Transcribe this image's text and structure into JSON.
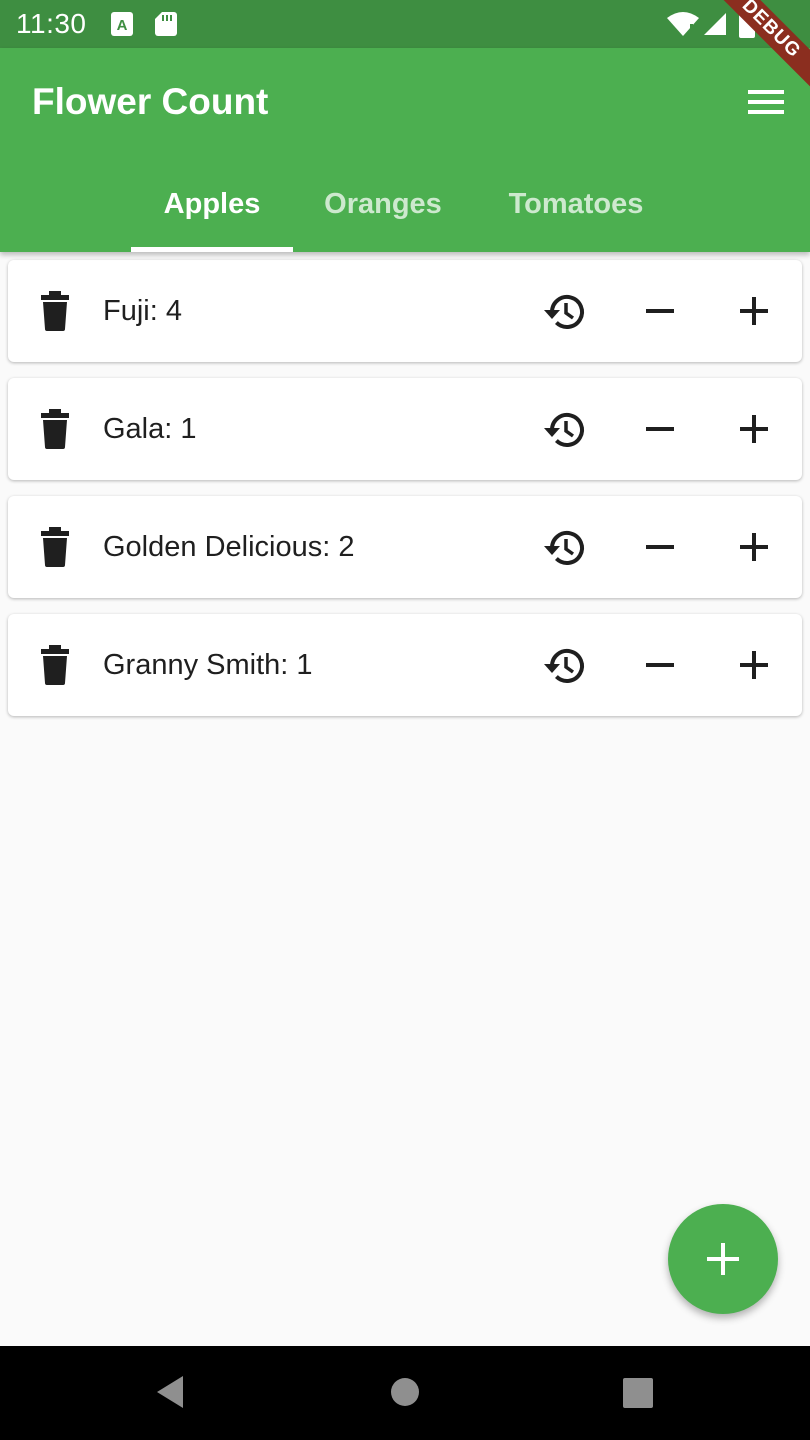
{
  "status_bar": {
    "time": "11:30",
    "icons": [
      "notification-a-icon",
      "sd-card-icon",
      "wifi-icon",
      "signal-icon",
      "battery-icon"
    ]
  },
  "debug_banner": {
    "text": "DEBUG"
  },
  "app_bar": {
    "title": "Flower Count",
    "menu_icon": "menu-icon",
    "background_color": "#4caf50"
  },
  "tabs": [
    {
      "label": "Apples",
      "selected": true
    },
    {
      "label": "Oranges",
      "selected": false
    },
    {
      "label": "Tomatoes",
      "selected": false
    }
  ],
  "items": [
    {
      "label": "Fuji: 4"
    },
    {
      "label": "Gala: 1"
    },
    {
      "label": "Golden Delicious: 2"
    },
    {
      "label": "Granny Smith: 1"
    }
  ],
  "item_actions": [
    "delete-icon",
    "history-icon",
    "decrement-icon",
    "increment-icon"
  ],
  "fab": {
    "icon": "add-icon"
  },
  "nav_bar": {
    "icons": [
      "back-icon",
      "home-icon",
      "recents-icon"
    ]
  }
}
